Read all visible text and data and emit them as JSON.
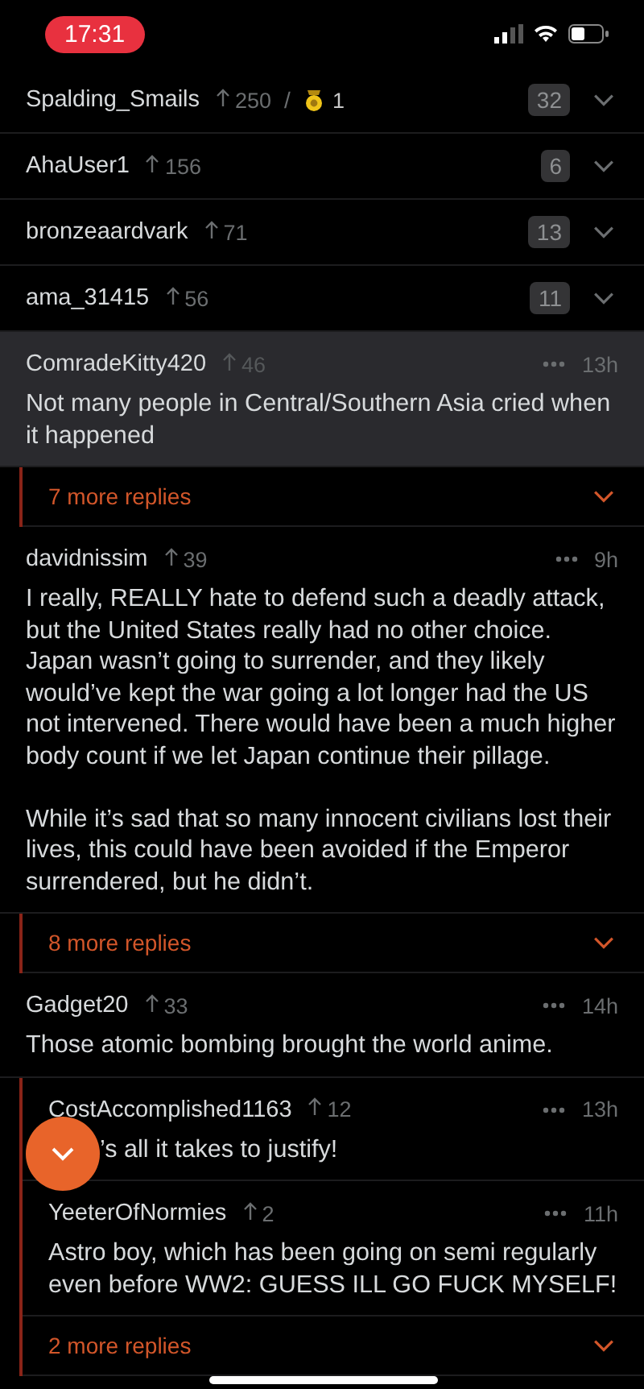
{
  "status_bar": {
    "time": "17:31"
  },
  "items": [
    {
      "kind": "collapsed",
      "user": "Spalding_Smails",
      "score": "250",
      "separator": "/",
      "awards": "1",
      "count": "32"
    },
    {
      "kind": "collapsed",
      "user": "AhaUser1",
      "score": "156",
      "count": "6"
    },
    {
      "kind": "collapsed",
      "user": "bronzeaardvark",
      "score": "71",
      "count": "13"
    },
    {
      "kind": "collapsed",
      "user": "ama_31415",
      "score": "56",
      "count": "11"
    },
    {
      "kind": "comment",
      "user": "ComradeKitty420",
      "score": "46",
      "time": "13h",
      "highlighted": true,
      "body": [
        "Not many people in Central/Southern Asia cried when it happened"
      ],
      "children": [
        {
          "kind": "more",
          "label": "7 more replies"
        }
      ]
    },
    {
      "kind": "comment",
      "user": "davidnissim",
      "score": "39",
      "time": "9h",
      "highlighted": false,
      "body": [
        "I really, REALLY hate to defend such a deadly attack, but the United States really had no other choice. Japan wasn’t going to surrender, and they likely would’ve kept the war going a lot longer had the US not intervened. There would have been a much higher body count if we let Japan continue their pillage.",
        "While it’s sad that so many innocent civilians lost their lives, this could have been avoided if the Emperor surrendered, but he didn’t."
      ],
      "children": [
        {
          "kind": "more",
          "label": "8 more replies"
        }
      ]
    },
    {
      "kind": "comment",
      "user": "Gadget20",
      "score": "33",
      "time": "14h",
      "highlighted": false,
      "body": [
        "Those atomic bombing brought the world anime."
      ],
      "children": [
        {
          "kind": "comment",
          "user": "CostAccomplished1163",
          "score": "12",
          "time": "13h",
          "highlighted": false,
          "covered_by_button": true,
          "body": [
            "’s all it takes to justify!"
          ]
        },
        {
          "kind": "comment",
          "user": "YeeterOfNormies",
          "score": "2",
          "time": "11h",
          "highlighted": false,
          "body": [
            "Astro boy, which has been going on semi regularly even before WW2: GUESS ILL GO FUCK MYSELF!"
          ]
        },
        {
          "kind": "more",
          "label": "2 more replies"
        }
      ]
    }
  ]
}
